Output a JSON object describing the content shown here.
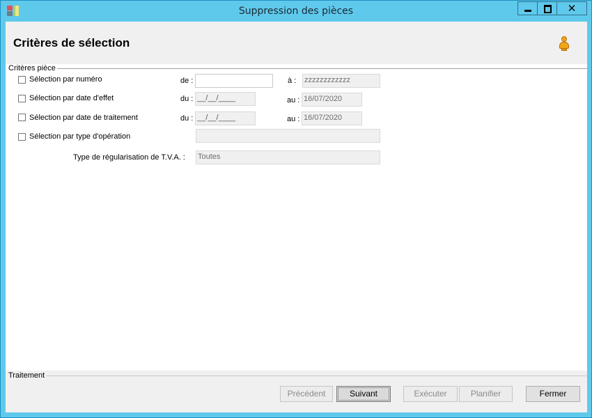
{
  "window": {
    "title": "Suppression des pièces",
    "close_label": "✕"
  },
  "header": {
    "title": "Critères de sélection"
  },
  "group_criteria": {
    "label": "Critères pièce"
  },
  "rows": {
    "numero": {
      "label": "Sélection par numéro",
      "from_prefix": "de :",
      "from_value": "",
      "to_prefix": "à :",
      "to_value": "zzzzzzzzzzzz"
    },
    "date_effet": {
      "label": "Sélection par date d'effet",
      "from_prefix": "du :",
      "from_value": "__/__/____",
      "to_prefix": "au :",
      "to_value": "16/07/2020"
    },
    "date_traitement": {
      "label": "Sélection par date de traitement",
      "from_prefix": "du :",
      "from_value": "__/__/____",
      "to_prefix": "au :",
      "to_value": "16/07/2020"
    },
    "type_operation": {
      "label": "Sélection par type d'opération",
      "value": ""
    },
    "type_tva": {
      "label": "Type de régularisation de T.V.A. :",
      "value": "Toutes"
    }
  },
  "group_treatment": {
    "label": "Traitement"
  },
  "buttons": {
    "previous": "Précédent",
    "next": "Suivant",
    "execute": "Exécuter",
    "plan": "Planifier",
    "close": "Fermer"
  },
  "colors": {
    "titlebar": "#5fc9ec",
    "header_bg": "#f0f0f0",
    "user_icon": "#f3a51b"
  }
}
